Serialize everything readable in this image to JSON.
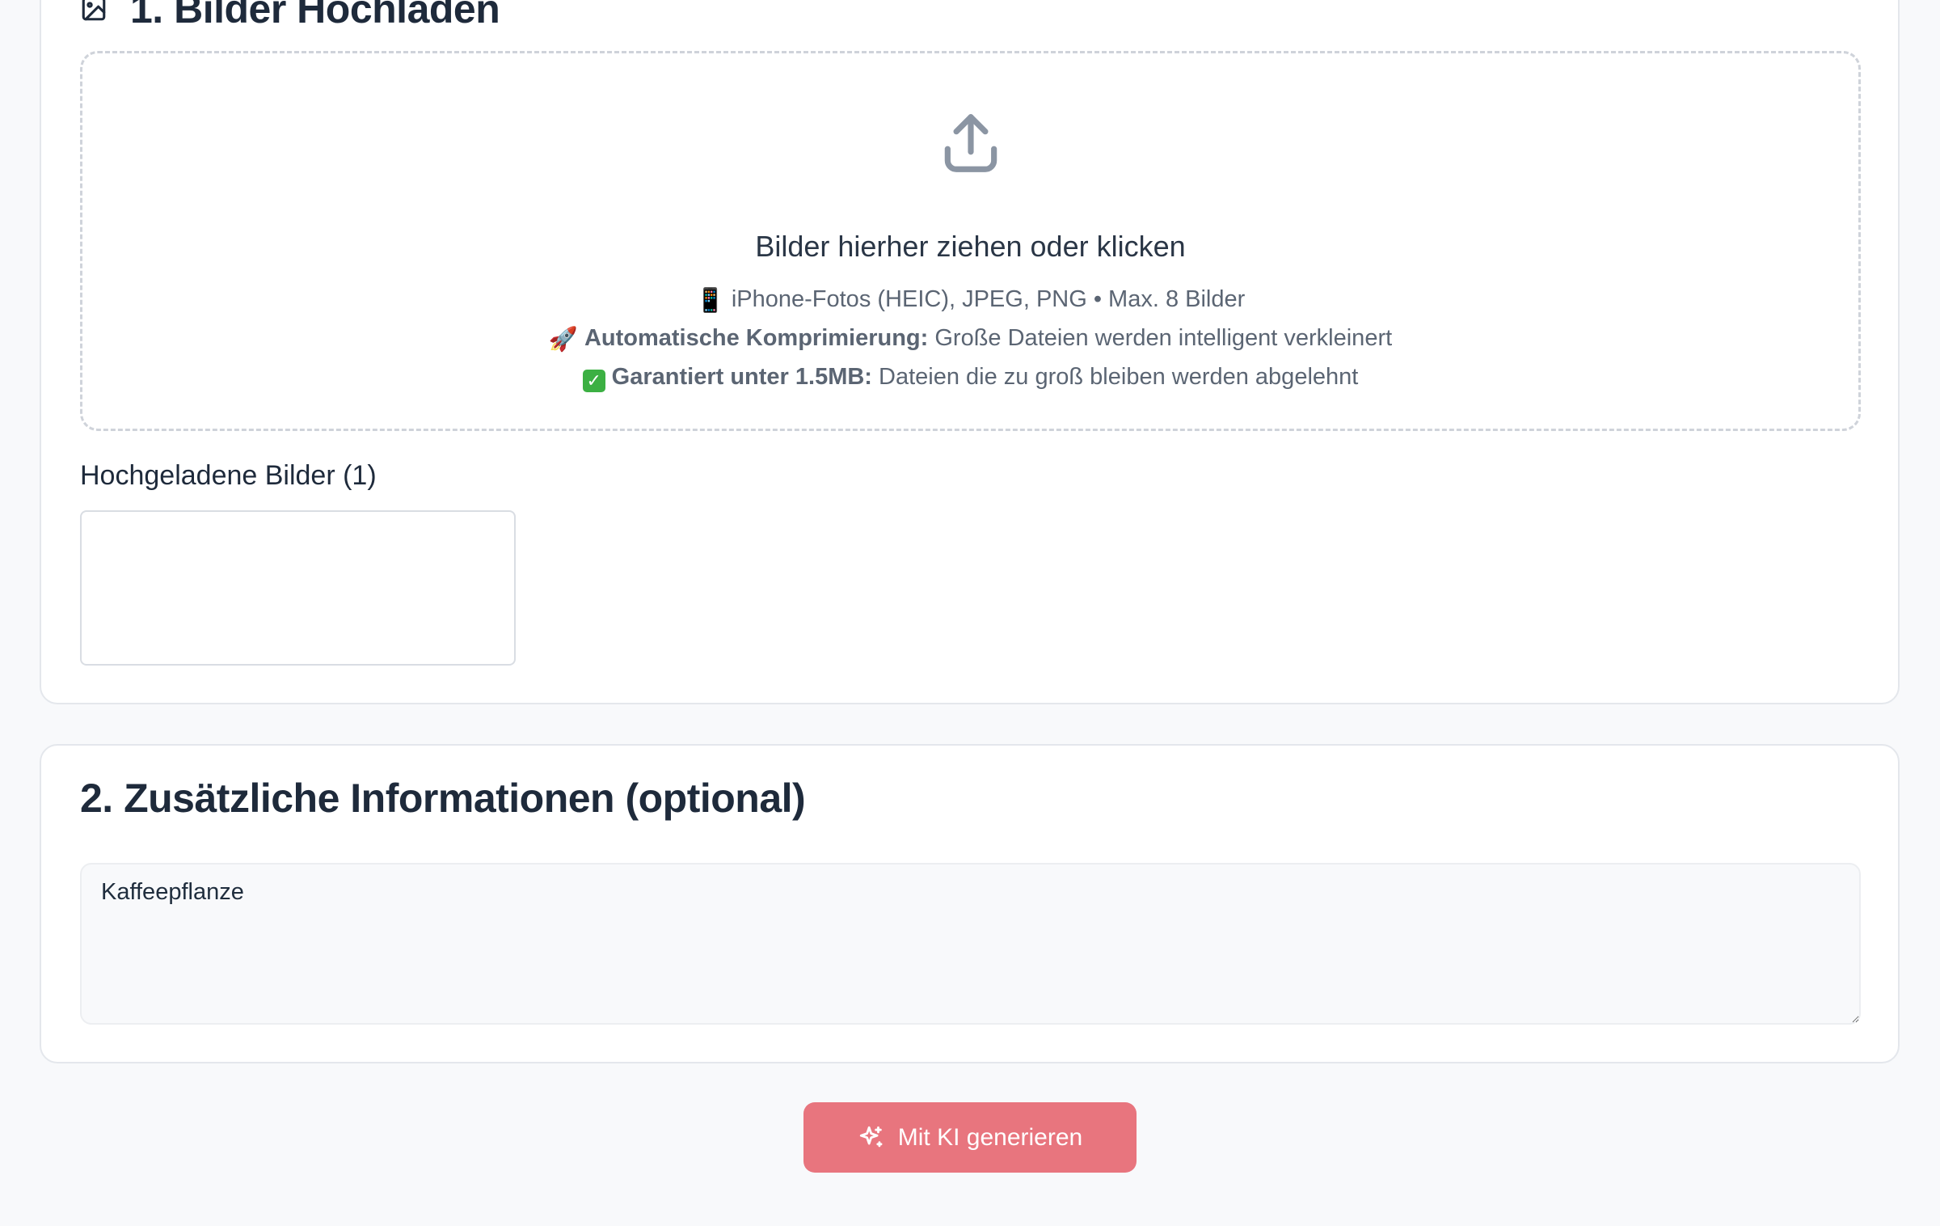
{
  "colors": {
    "page_background": "#f8f9fb",
    "card_background": "#ffffff",
    "title_text": "#1e2a3b",
    "muted_text": "#5b6573",
    "icon_gray": "#8b95a3",
    "button_background": "#e8757e",
    "button_text": "#ffffff"
  },
  "upload_section": {
    "title": "1. Bilder Hochladen",
    "title_icon": "image-icon",
    "dropzone": {
      "icon": "upload-icon",
      "title": "Bilder hierher ziehen oder klicken",
      "line1": {
        "emoji": "📱",
        "text": "iPhone-Fotos (HEIC), JPEG, PNG • Max. 8 Bilder"
      },
      "line2": {
        "emoji": "🚀",
        "bold": "Automatische Komprimierung:",
        "text": "Große Dateien werden intelligent verkleinert"
      },
      "line3": {
        "emoji": "✅",
        "bold": "Garantiert unter 1.5MB:",
        "text": "Dateien die zu groß bleiben werden abgelehnt"
      }
    },
    "uploaded_label": "Hochgeladene Bilder (1)"
  },
  "info_section": {
    "title": "2. Zusätzliche Informationen (optional)",
    "textarea_value": "Kaffeepflanze"
  },
  "generate_button": {
    "icon": "sparkle-icon",
    "label": "Mit KI generieren"
  }
}
